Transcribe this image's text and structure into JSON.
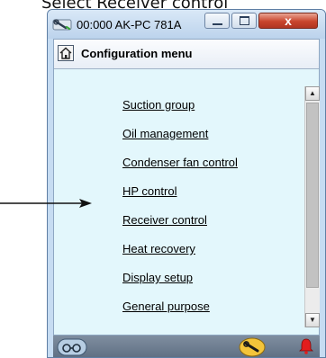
{
  "caption": "Select Receiver control",
  "window": {
    "title": "00:000 AK-PC 781A",
    "close_glyph": "x",
    "app_icon": "wrench-icon"
  },
  "header": {
    "title": "Configuration menu",
    "home_icon": "home-icon"
  },
  "menu": {
    "items": [
      {
        "label": "Suction group"
      },
      {
        "label": "Oil management"
      },
      {
        "label": "Condenser fan control"
      },
      {
        "label": "HP control"
      },
      {
        "label": "Receiver control"
      },
      {
        "label": "Heat recovery"
      },
      {
        "label": "Display setup"
      },
      {
        "label": "General purpose"
      }
    ]
  },
  "scrollbar": {
    "up_glyph": "▲",
    "down_glyph": "▼"
  },
  "status": {
    "left_icon": "glasses-icon",
    "wrench_icon": "wrench-icon",
    "alarm_icon": "alarm-bell-icon"
  },
  "annotation": {
    "arrow_target": "Receiver control"
  }
}
